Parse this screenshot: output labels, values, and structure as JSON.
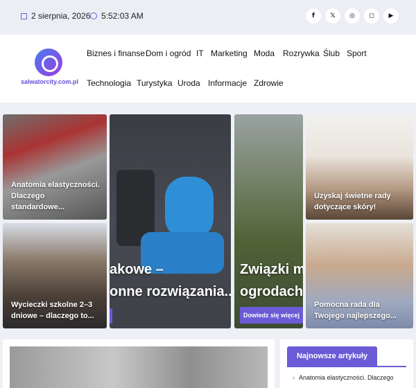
{
  "topbar": {
    "date": "2 sierpnia, 2026",
    "time": "5:52:03 AM",
    "social": [
      "f",
      "𝕏",
      "◎",
      "◻",
      "▶"
    ]
  },
  "header": {
    "logo_text": "salwatorcity.com.pl",
    "nav_row1": [
      "Biznes i finanse",
      "Dom i ogród",
      "IT",
      "Marketing",
      "Moda",
      "Rozrywka",
      "Ślub",
      "Sport"
    ],
    "nav_row2": [
      "Technologia",
      "Turystyka",
      "Uroda",
      "Informacje",
      "Zdrowie"
    ]
  },
  "cards": {
    "card1": "Anatomia elastyczności. Dlaczego standardowe...",
    "card2": "Wycieczki szkolne 2–3 dniowe – dlaczego to...",
    "card3_line1": "akowe –",
    "card3_line2": "onne rozwiązania...",
    "card4_line1": "Związki mi",
    "card4_line2": "ogrodach r",
    "card4_button": "Dowiedz się więcej",
    "card5": "Uzyskaj świetne rady dotyczące skóry!",
    "card6": "Pomocna rada dla Twojego najlepszego..."
  },
  "sidebar": {
    "title": "Najnowsze artykuły",
    "item1": "Anatomia elastyczności. Dlaczego"
  },
  "colors": {
    "accent": "#6b5bd6"
  }
}
